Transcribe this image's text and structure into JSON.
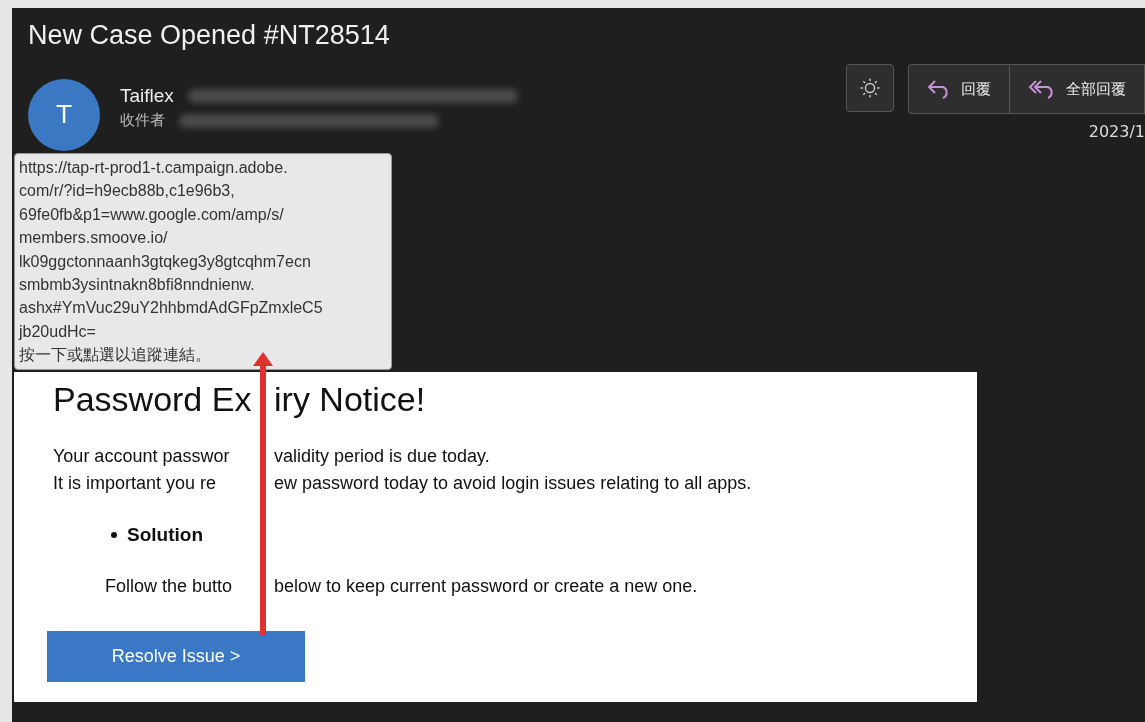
{
  "email": {
    "subject": "New Case Opened #NT28514",
    "sender": {
      "initial": "T",
      "name": "Taiflex"
    },
    "to_label": "收件者",
    "date": "2023/1"
  },
  "toolbar": [
    {
      "kind": "theme"
    },
    {
      "kind": "reply",
      "label": "回覆"
    },
    {
      "kind": "reply_all",
      "label": "全部回覆"
    }
  ],
  "link_tooltip": {
    "url_lines": [
      "https://tap-rt-prod1-t.campaign.adobe.",
      "com/r/?id=h9ecb88b,c1e96b3,",
      "69fe0fb&p1=www.google.com/amp/s/",
      "members.smoove.io/",
      "lk09ggctonnaanh3gtqkeg3y8gtcqhm7ecn",
      "smbmb3ysintnakn8bfi8nndnienw.",
      "ashx#YmVuc29uY2hhbmdAdGFpZmxleC5",
      "jb20udHc="
    ],
    "hint": "按一下或點選以追蹤連結。"
  },
  "message": {
    "heading": [
      "Password Ex",
      "iry Notice!"
    ],
    "paragraphs": [
      [
        "Your account passwor",
        "validity period is due today."
      ],
      [
        "It is important you re",
        "ew password today to avoid login issues relating to all apps."
      ]
    ],
    "bullet": "Solution",
    "instruction": [
      "Follow the butto",
      "below to keep current password or create a new one."
    ],
    "button": "Resolve Issue >"
  }
}
